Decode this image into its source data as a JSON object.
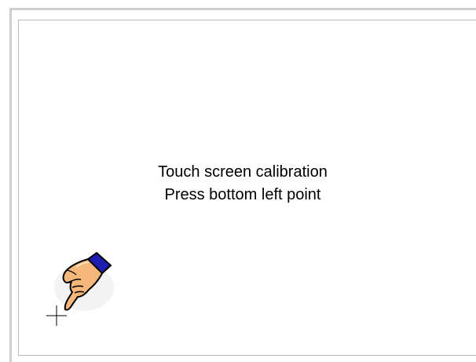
{
  "calibration": {
    "title": "Touch screen calibration",
    "instruction": "Press bottom left point"
  },
  "icons": {
    "pointer": "pointing-hand-icon",
    "target": "crosshair-icon"
  },
  "colors": {
    "background": "#ffffff",
    "frame": "#cfcfcf",
    "cuff": "#1d1db0",
    "skin": "#f5b77a"
  }
}
